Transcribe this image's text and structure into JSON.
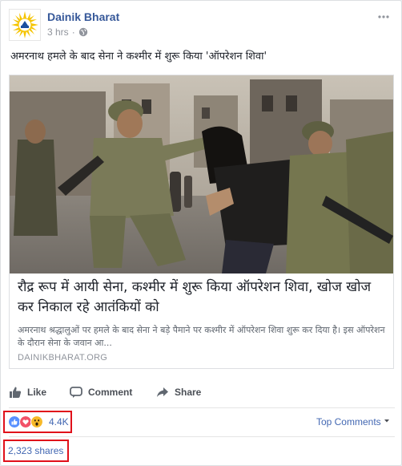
{
  "post": {
    "page_name": "Dainik Bharat",
    "time": "3 hrs",
    "separator": "·",
    "text": "अमरनाथ हमले के बाद सेना ने कश्मीर में शुरू किया 'ऑपरेशन शिवा'"
  },
  "link": {
    "title": "रौद्र रूप में आयी सेना, कश्मीर में शुरू किया ऑपरेशन शिवा, खोज खोज कर निकाल रहे आतंकियों को",
    "description": "अमरनाथ श्रद्धालुओं पर हमले के बाद सेना ने बड़े पैमाने पर कश्मीर में ऑपरेशन शिवा शुरू कर दिया है। इस ऑपरेशन के दौरान सेना के जवान आ...",
    "domain": "DAINIKBHARAT.ORG"
  },
  "actions": {
    "like": "Like",
    "comment": "Comment",
    "share": "Share"
  },
  "stats": {
    "reactions_count": "4.4K",
    "top_comments": "Top Comments",
    "shares": "2,323 shares"
  },
  "icons": [
    "globe-icon",
    "more-options-icon",
    "like-thumb-icon",
    "comment-bubble-icon",
    "share-arrow-icon",
    "like-reaction-icon",
    "love-reaction-icon",
    "wow-reaction-icon",
    "dropdown-caret-icon",
    "dainik-bharat-logo"
  ],
  "colors": {
    "link_blue": "#365899",
    "count_blue": "#4267b2",
    "highlight_red": "#e0101a",
    "like_reaction": "#5890ff",
    "love_reaction": "#f25268",
    "wow_reaction": "#f7b928"
  }
}
